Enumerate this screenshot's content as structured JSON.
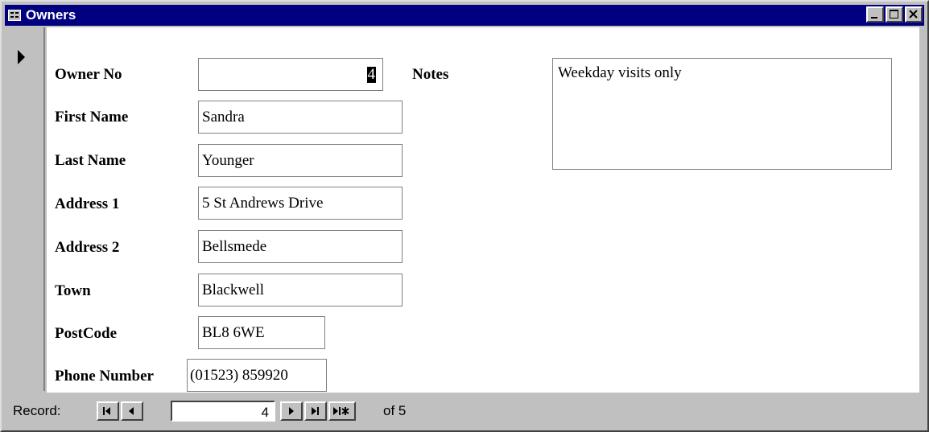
{
  "window": {
    "title": "Owners",
    "icon": "form-view-icon",
    "controls": [
      "minimize-icon",
      "maximize-icon",
      "close-icon"
    ]
  },
  "form": {
    "owner_no": {
      "label": "Owner No",
      "value": "4"
    },
    "first_name": {
      "label": "First Name",
      "value": "Sandra"
    },
    "last_name": {
      "label": "Last Name",
      "value": "Younger"
    },
    "address1": {
      "label": "Address 1",
      "value": "5 St Andrews Drive"
    },
    "address2": {
      "label": "Address 2",
      "value": "Bellsmede"
    },
    "town": {
      "label": "Town",
      "value": "Blackwell"
    },
    "postcode": {
      "label": "PostCode",
      "value": "BL8 6WE"
    },
    "phone": {
      "label": "Phone Number",
      "value": "(01523) 859920"
    },
    "notes": {
      "label": "Notes",
      "value": "Weekday visits only"
    }
  },
  "navigation": {
    "label": "Record:",
    "current": "4",
    "of_text": "of 5",
    "buttons": [
      "first-record-icon",
      "previous-record-icon",
      "next-record-icon",
      "last-record-icon",
      "new-record-icon"
    ]
  }
}
